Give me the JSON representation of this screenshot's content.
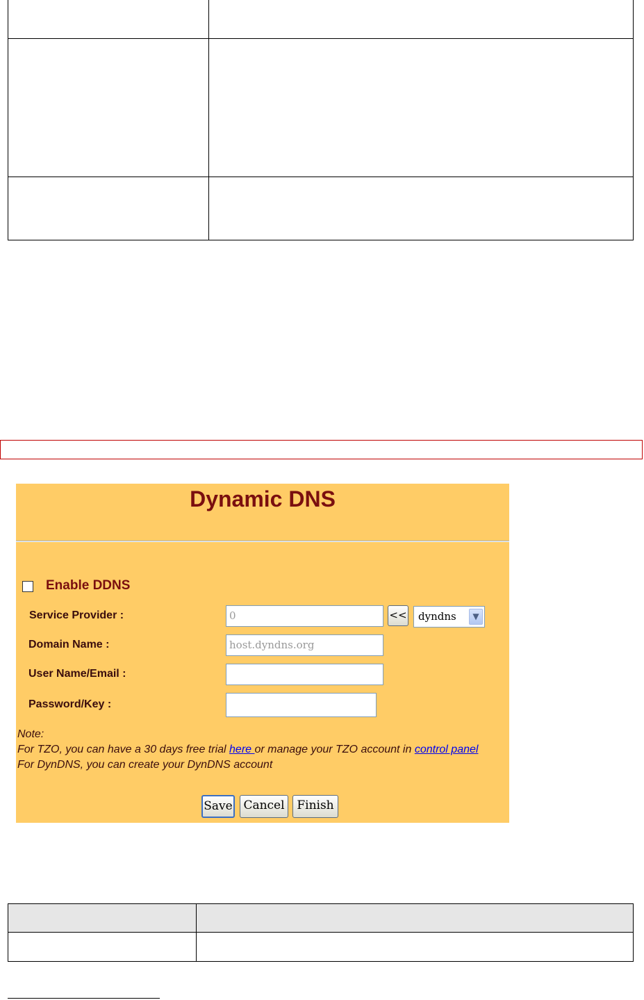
{
  "dynamic_dns": {
    "title": "Dynamic DNS",
    "enable_label": "Enable DDNS",
    "enable_checked": false,
    "service_provider_label": "Service Provider :",
    "service_provider_value": "0",
    "arrow_button_label": "<<",
    "provider_select_value": "dyndns",
    "domain_name_label": "Domain Name :",
    "domain_name_placeholder": "host.dyndns.org",
    "user_name_label": "User Name/Email :",
    "user_name_value": "",
    "password_label": "Password/Key :",
    "password_value": "",
    "note": {
      "heading": "Note:",
      "line1_prefix": "For TZO, you can have a 30 days free trial ",
      "link_here": "here ",
      "line1_middle": "or manage your TZO account in ",
      "link_control_panel": "control panel",
      "line2": "For DynDNS, you can create your DynDNS account"
    },
    "buttons": {
      "save": "Save",
      "cancel": "Cancel",
      "finish": "Finish"
    }
  },
  "colors": {
    "panel_bg": "#ffcc66",
    "title": "#7a0f0f",
    "border_red": "#c00000"
  }
}
